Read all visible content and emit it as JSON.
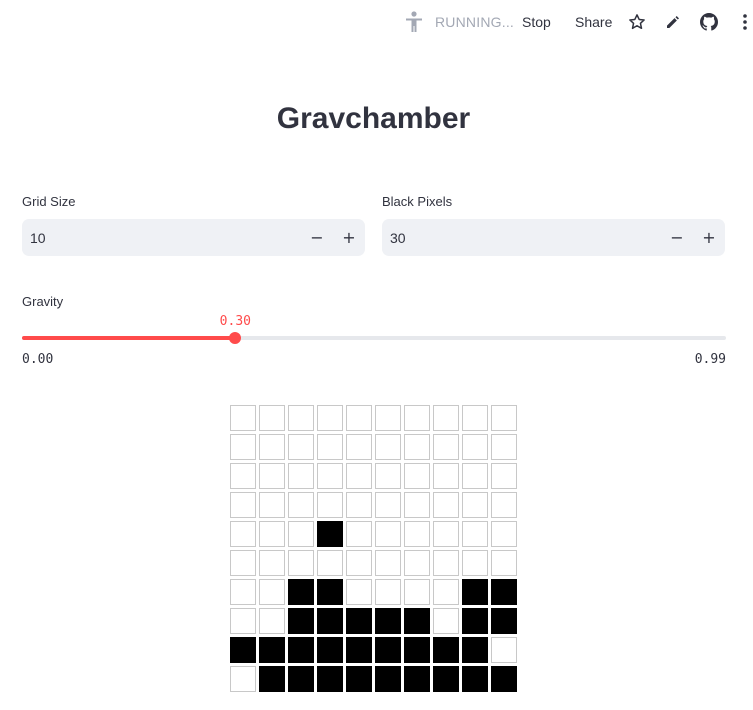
{
  "toolbar": {
    "running_icon": "running-person-icon",
    "running_label": "RUNNING...",
    "stop_label": "Stop",
    "share_label": "Share",
    "star_icon": "star-icon",
    "edit_icon": "pencil-icon",
    "github_icon": "github-icon",
    "menu_icon": "kebab-menu-icon"
  },
  "title": "Gravchamber",
  "grid_size": {
    "label": "Grid Size",
    "value": "10",
    "minus": "−",
    "plus": "+"
  },
  "black_pixels": {
    "label": "Black Pixels",
    "value": "30",
    "minus": "−",
    "plus": "+"
  },
  "gravity": {
    "label": "Gravity",
    "value_label": "0.30",
    "value": 0.3,
    "min_label": "0.00",
    "max_label": "0.99",
    "min": 0.0,
    "max": 0.99
  },
  "colors": {
    "accent": "#ff4b4b",
    "input_bg": "#eff1f5",
    "text": "#31333f",
    "pixel_on": "#000000",
    "pixel_off": "#ffffff"
  },
  "pixel_grid": [
    [
      0,
      0,
      0,
      0,
      0,
      0,
      0,
      0,
      0,
      0
    ],
    [
      0,
      0,
      0,
      0,
      0,
      0,
      0,
      0,
      0,
      0
    ],
    [
      0,
      0,
      0,
      0,
      0,
      0,
      0,
      0,
      0,
      0
    ],
    [
      0,
      0,
      0,
      0,
      0,
      0,
      0,
      0,
      0,
      0
    ],
    [
      0,
      0,
      0,
      1,
      0,
      0,
      0,
      0,
      0,
      0
    ],
    [
      0,
      0,
      0,
      0,
      0,
      0,
      0,
      0,
      0,
      0
    ],
    [
      0,
      0,
      1,
      1,
      0,
      0,
      0,
      0,
      1,
      1
    ],
    [
      0,
      0,
      1,
      1,
      1,
      1,
      1,
      0,
      1,
      1
    ],
    [
      1,
      1,
      1,
      1,
      1,
      1,
      1,
      1,
      1,
      0
    ],
    [
      0,
      1,
      1,
      1,
      1,
      1,
      1,
      1,
      1,
      1
    ]
  ]
}
